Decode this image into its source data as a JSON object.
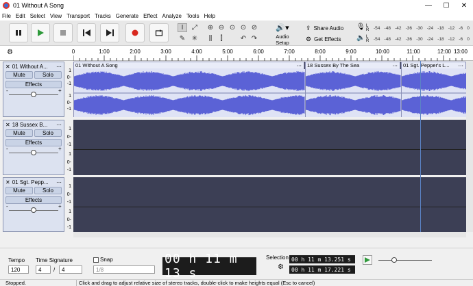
{
  "window": {
    "title": "01 Without A Song",
    "minimize": "—",
    "maximize": "☐",
    "close": "✕"
  },
  "menu": [
    "File",
    "Edit",
    "Select",
    "View",
    "Transport",
    "Tracks",
    "Generate",
    "Effect",
    "Analyze",
    "Tools",
    "Help"
  ],
  "toolbar": {
    "transport": [
      "pause-icon",
      "play-icon",
      "stop-icon",
      "skip-start-icon",
      "skip-end-icon",
      "record-icon",
      "loop-icon"
    ],
    "audio_setup_label": "Audio Setup",
    "share_audio_label": "Share Audio",
    "get_effects_label": "Get Effects",
    "meter_ticks": [
      "-54",
      "-48",
      "-42",
      "-36",
      "-30",
      "-24",
      "-18",
      "-12",
      "-6",
      "0"
    ],
    "meter_channels": [
      "L",
      "R"
    ]
  },
  "ruler": {
    "ticks": [
      "0",
      "1:00",
      "2:00",
      "3:00",
      "4:00",
      "5:00",
      "6:00",
      "7:00",
      "8:00",
      "9:00",
      "10:00",
      "11:00",
      "12:00",
      "13:00"
    ]
  },
  "tracks": [
    {
      "name": "01 Without A...",
      "mute": "Mute",
      "solo": "Solo",
      "effects": "Effects",
      "close": "✕",
      "menu": "⋯",
      "pan_minus": "-",
      "pan_plus": "+"
    },
    {
      "name": "18 Sussex B...",
      "mute": "Mute",
      "solo": "Solo",
      "effects": "Effects",
      "close": "✕",
      "menu": "⋯",
      "pan_minus": "-",
      "pan_plus": "+"
    },
    {
      "name": "01 Sgt. Pepp...",
      "mute": "Mute",
      "solo": "Solo",
      "effects": "Effects",
      "close": "✕",
      "menu": "⋯",
      "pan_minus": "-",
      "pan_plus": "+"
    }
  ],
  "clips": [
    {
      "name": "01 Without A Song",
      "menu": "⋯"
    },
    {
      "name": "18 Sussex By The Sea",
      "menu": "⋯"
    },
    {
      "name": "01 Sgt. Pepper's L...",
      "menu": "⋯"
    }
  ],
  "scale_labels": [
    "1",
    "0-",
    "-1"
  ],
  "bottom": {
    "tempo_label": "Tempo",
    "tempo_value": "120",
    "time_signature_label": "Time Signature",
    "ts_numerator": "4",
    "ts_denominator": "4",
    "snap_label": "Snap",
    "snap_value": "1/8",
    "time_display": "00 h 11 m 13 s",
    "selection_label": "Selection",
    "selection_start": "00 h 11 m 13.251 s",
    "selection_end": "00 h 17.221 s",
    "selection_end_full": "00 h 11 m 17.221 s"
  },
  "status": {
    "state": "Stopped.",
    "hint": "Click and drag to adjust relative size of stereo tracks, double-click to make heights equal (Esc to cancel)"
  },
  "colors": {
    "waveform": "#5b62d6",
    "lane": "#3c3f55",
    "track_panel": "#dce2f0",
    "selected_clip": "#dfe3f5"
  }
}
